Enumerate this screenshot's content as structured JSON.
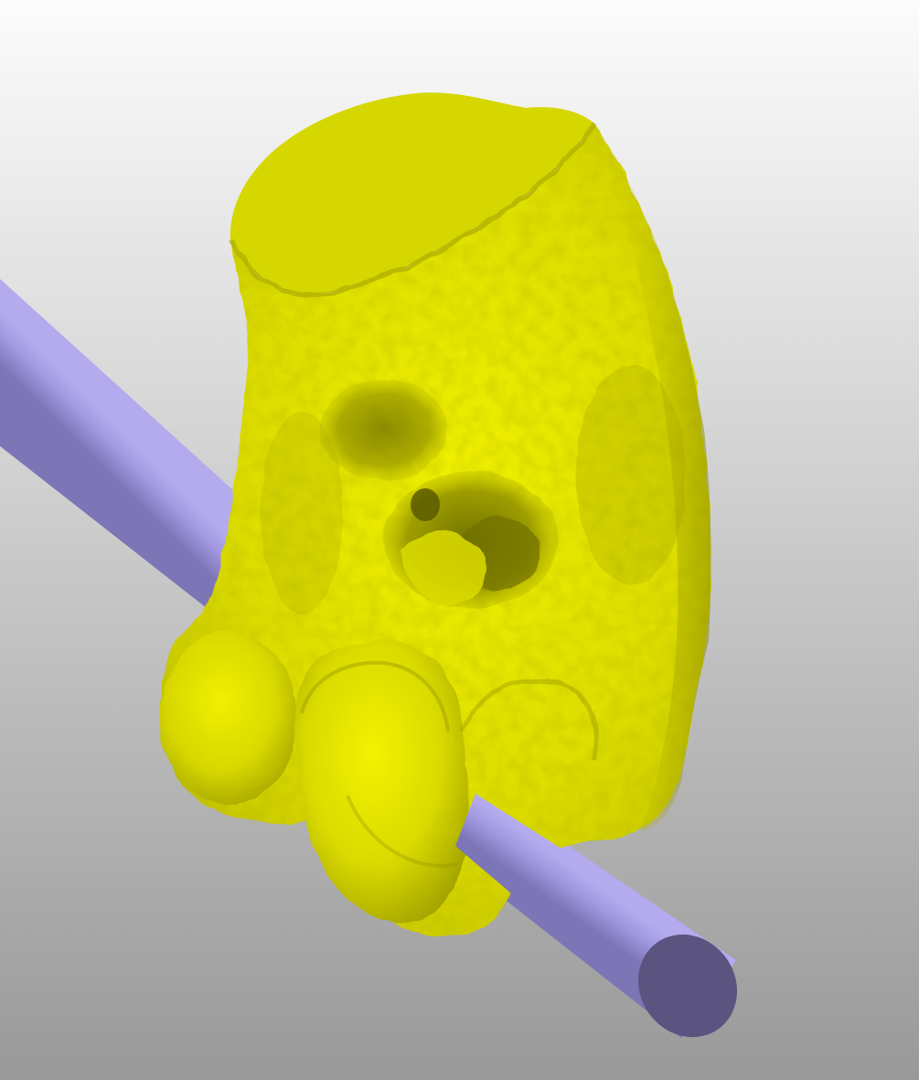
{
  "viewport": {
    "background_top_color": "#fcfcfc",
    "background_bottom_color": "#999999"
  },
  "scene": {
    "bone_model": {
      "color": "#e6e600",
      "cut_face_color": "#d6d600",
      "shadow_color": "#7a7a00"
    },
    "cylinder_axis": {
      "color": "#9f96de",
      "end_cap_color": "#5b5480",
      "dark_side_color": "#7d76b8"
    }
  }
}
